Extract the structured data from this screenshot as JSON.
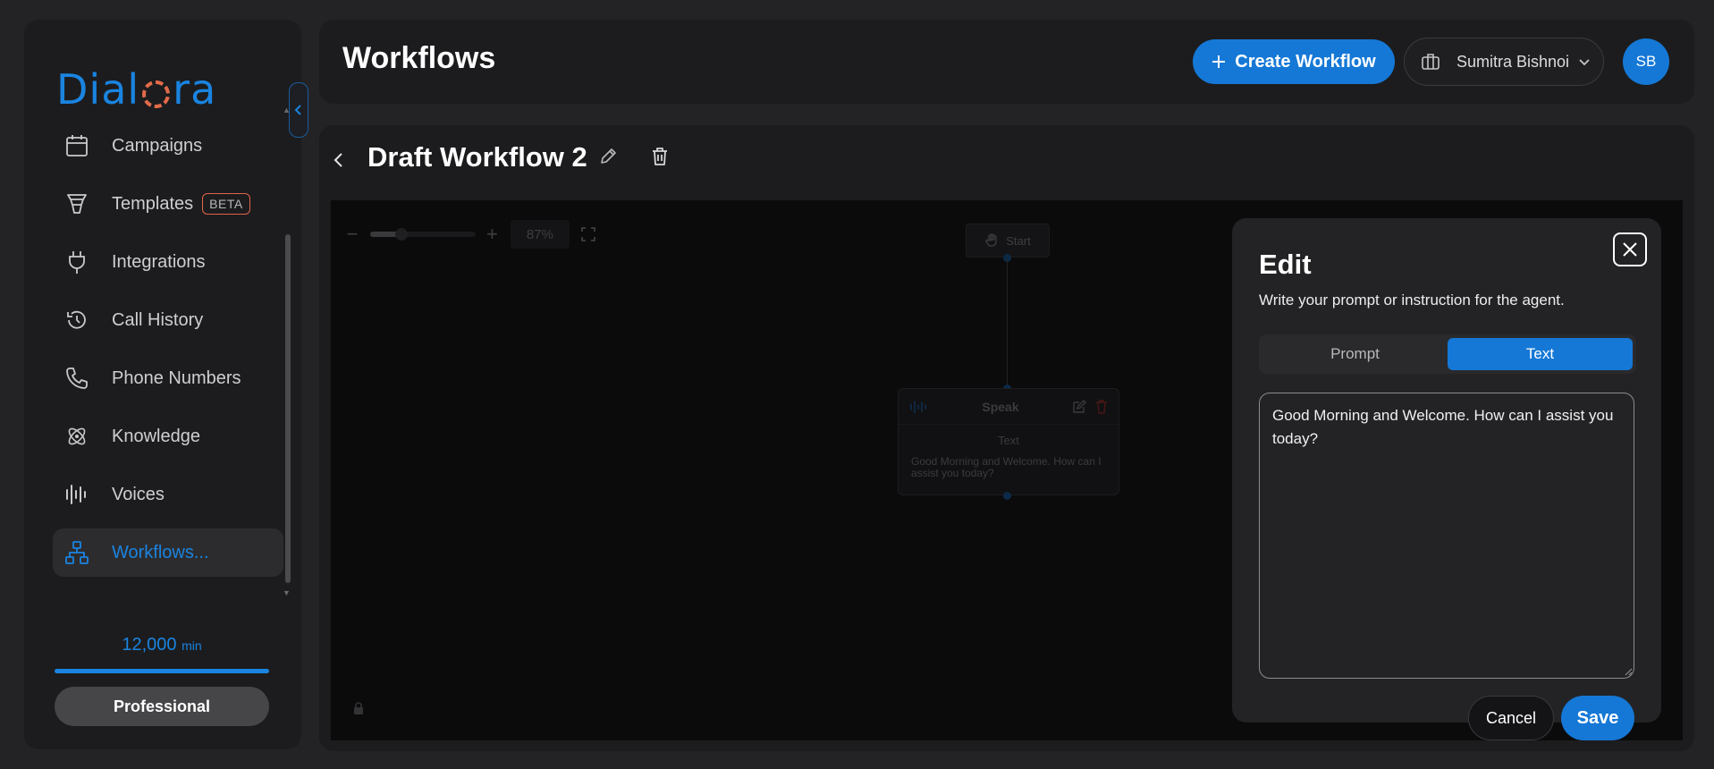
{
  "brand": {
    "logo_text_left": "Dial",
    "logo_text_right": "ra"
  },
  "sidebar": {
    "items": [
      {
        "label": "Campaigns",
        "icon": "calendar-icon"
      },
      {
        "label": "Templates",
        "icon": "funnel-icon",
        "badge": "BETA"
      },
      {
        "label": "Integrations",
        "icon": "plug-icon"
      },
      {
        "label": "Call History",
        "icon": "history-icon"
      },
      {
        "label": "Phone Numbers",
        "icon": "phone-icon"
      },
      {
        "label": "Knowledge",
        "icon": "atom-icon"
      },
      {
        "label": "Voices",
        "icon": "waveform-icon"
      },
      {
        "label": "Workflows...",
        "icon": "workflow-icon",
        "active": true
      }
    ],
    "minutes_value": "12,000",
    "minutes_unit": "min",
    "plan_label": "Professional"
  },
  "header": {
    "title": "Workflows",
    "create_label": "Create Workflow",
    "account_name": "Sumitra Bishnoi",
    "avatar_initials": "SB"
  },
  "workflow": {
    "name": "Draft Workflow 2",
    "canvas": {
      "zoom_label": "87%",
      "start_node_label": "Start",
      "speak_node": {
        "title": "Speak",
        "subtitle": "Text",
        "text": "Good Morning and Welcome. How can I assist you today?"
      }
    }
  },
  "dialog": {
    "title": "Edit",
    "subtitle": "Write your prompt or instruction for the agent.",
    "tabs": [
      {
        "label": "Prompt",
        "active": false
      },
      {
        "label": "Text",
        "active": true
      }
    ],
    "text_value": "Good Morning and Welcome. How can I assist you today?",
    "cancel_label": "Cancel",
    "save_label": "Save"
  },
  "colors": {
    "accent": "#1578d6",
    "brand_blue": "#1a84e0",
    "brand_orange": "#e36b4a",
    "background": "#232325",
    "panel": "#1c1c1e"
  }
}
